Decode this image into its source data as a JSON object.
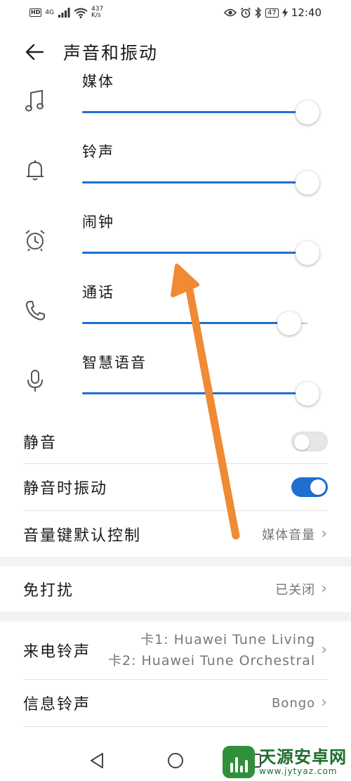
{
  "status_bar": {
    "hd": "HD",
    "network": "4G",
    "speed_value": "437",
    "speed_unit": "K/s",
    "battery": "47",
    "time": "12:40"
  },
  "header": {
    "title": "声音和振动"
  },
  "volumes": [
    {
      "label": "媒体",
      "icon": "music-note-icon",
      "level": 1.0
    },
    {
      "label": "铃声",
      "icon": "bell-icon",
      "level": 1.0
    },
    {
      "label": "闹钟",
      "icon": "alarm-clock-icon",
      "level": 1.0
    },
    {
      "label": "通话",
      "icon": "phone-icon",
      "level": 0.92
    },
    {
      "label": "智慧语音",
      "icon": "microphone-icon",
      "level": 1.0
    }
  ],
  "settings": {
    "mute": {
      "label": "静音",
      "on": false
    },
    "vibrate_on_mute": {
      "label": "静音时振动",
      "on": true
    },
    "volume_key": {
      "label": "音量键默认控制",
      "value": "媒体音量"
    },
    "dnd": {
      "label": "免打扰",
      "value": "已关闭"
    },
    "ringtone": {
      "label": "来电铃声",
      "sim1": "卡1: Huawei Tune Living",
      "sim2": "卡2: Huawei Tune Orchestral"
    },
    "message_tone": {
      "label": "信息铃声",
      "value": "Bongo"
    }
  },
  "colors": {
    "accent": "#1f6fd1",
    "annotation_arrow": "#f08a34"
  },
  "watermark": {
    "title": "天源安卓网",
    "url": "www.jytyaz.com"
  }
}
